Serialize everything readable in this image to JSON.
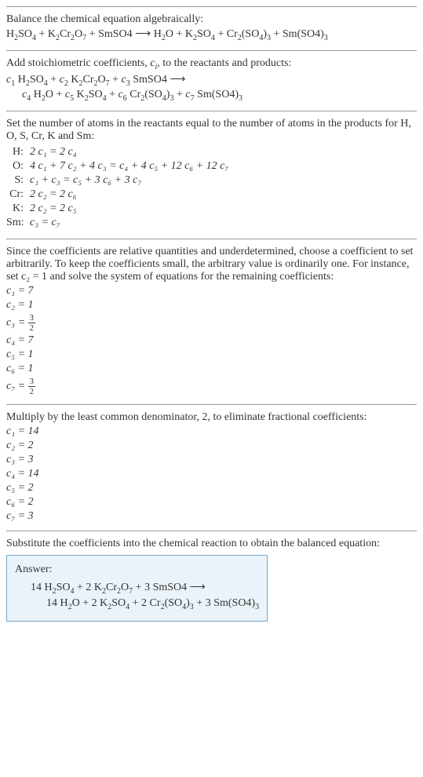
{
  "chart_data": {
    "type": "table",
    "title": "Chemical equation balancing steps",
    "unbalanced_equation": "H2SO4 + K2Cr2O7 + SmSO4 ⟶ H2O + K2SO4 + Cr2(SO4)3 + Sm(SO4)3",
    "atom_equations": {
      "H": "2 c1 = 2 c4",
      "O": "4 c1 + 7 c2 + 4 c3 = c4 + 4 c5 + 12 c6 + 12 c7",
      "S": "c1 + c3 = c5 + 3 c6 + 3 c7",
      "Cr": "2 c2 = 2 c6",
      "K": "2 c2 = 2 c5",
      "Sm": "c3 = c7"
    },
    "coefficients_fractional": {
      "c1": 7,
      "c2": 1,
      "c3": "3/2",
      "c4": 7,
      "c5": 1,
      "c6": 1,
      "c7": "3/2"
    },
    "coefficients_integer": {
      "c1": 14,
      "c2": 2,
      "c3": 3,
      "c4": 14,
      "c5": 2,
      "c6": 2,
      "c7": 3
    },
    "balanced_equation": "14 H2SO4 + 2 K2Cr2O7 + 3 SmSO4 ⟶ 14 H2O + 2 K2SO4 + 2 Cr2(SO4)3 + 3 Sm(SO4)3"
  },
  "s1": {
    "intro": "Balance the chemical equation algebraically:",
    "eq_lhs": "H",
    "eq_part2": "SO",
    "eq_part3": " + K",
    "eq_part4": "Cr",
    "eq_part5": "O",
    "eq_part6": " + SmSO4  ⟶  H",
    "eq_part7": "O + K",
    "eq_part8": "SO",
    "eq_part9": " + Cr",
    "eq_part10": "(SO",
    "eq_part11": ")",
    "eq_part12": " + Sm(SO4)",
    "sub2": "2",
    "sub4": "4",
    "sub7": "7",
    "sub3": "3"
  },
  "s2": {
    "intro1": "Add stoichiometric coefficients, ",
    "ci": "c",
    "sub_i": "i",
    "intro2": ", to the reactants and products:",
    "c1": "c",
    "sub1": "1",
    "sp1": " H",
    "sub2t": "2",
    "sp2": "SO",
    "sub4t": "4",
    "sp3": " + ",
    "c2": "c",
    "sub2c": "2",
    "sp4": " K",
    "sp5": "Cr",
    "sp6": "O",
    "sub7t": "7",
    "c3": "c",
    "sub3c": "3",
    "sp7": " SmSO4  ⟶",
    "c4": "c",
    "sub4c": "4",
    "sp8": " H",
    "sp9": "O + ",
    "c5": "c",
    "sub5c": "5",
    "sp10": " K",
    "sp11": "SO",
    "c6": "c",
    "sub6c": "6",
    "sp12": " Cr",
    "sp13": "(SO",
    "sp14": ")",
    "sub3t": "3",
    "c7": "c",
    "sub7c": "7",
    "sp15": " Sm(SO4)"
  },
  "s3": {
    "intro": "Set the number of atoms in the reactants equal to the number of atoms in the products for H, O, S, Cr, K and Sm:",
    "atoms": [
      {
        "label": "H:",
        "eq": "2 c₁ = 2 c₄"
      },
      {
        "label": "O:",
        "eq": "4 c₁ + 7 c₂ + 4 c₃ = c₄ + 4 c₅ + 12 c₆ + 12 c₇"
      },
      {
        "label": "S:",
        "eq": "c₁ + c₃ = c₅ + 3 c₆ + 3 c₇"
      },
      {
        "label": "Cr:",
        "eq": "2 c₂ = 2 c₆"
      },
      {
        "label": "K:",
        "eq": "2 c₂ = 2 c₅"
      },
      {
        "label": "Sm:",
        "eq": "c₃ = c₇"
      }
    ]
  },
  "s4": {
    "intro": "Since the coefficients are relative quantities and underdetermined, choose a coefficient to set arbitrarily. To keep the coefficients small, the arbitrary value is ordinarily one. For instance, set c₂ = 1 and solve the system of equations for the remaining coefficients:",
    "c1": "c₁ = 7",
    "c2": "c₂ = 1",
    "c3p": "c₃ = ",
    "c4": "c₄ = 7",
    "c5": "c₅ = 1",
    "c6": "c₆ = 1",
    "c7p": "c₇ = ",
    "num3": "3",
    "den2": "2"
  },
  "s5": {
    "intro": "Multiply by the least common denominator, 2, to eliminate fractional coefficients:",
    "c1": "c₁ = 14",
    "c2": "c₂ = 2",
    "c3": "c₃ = 3",
    "c4": "c₄ = 14",
    "c5": "c₅ = 2",
    "c6": "c₆ = 2",
    "c7": "c₇ = 3"
  },
  "s6": {
    "intro": "Substitute the coefficients into the chemical reaction to obtain the balanced equation:",
    "answer_label": "Answer:",
    "ans_p1": "14 H",
    "ans_p2": "SO",
    "ans_p3": " + 2 K",
    "ans_p4": "Cr",
    "ans_p5": "O",
    "ans_p6": " + 3 SmSO4  ⟶",
    "ans_p7": "14 H",
    "ans_p8": "O + 2 K",
    "ans_p9": "SO",
    "ans_p10": " + 2 Cr",
    "ans_p11": "(SO",
    "ans_p12": ")",
    "ans_p13": " + 3 Sm(SO4)",
    "sub2": "2",
    "sub4": "4",
    "sub7": "7",
    "sub3": "3"
  }
}
